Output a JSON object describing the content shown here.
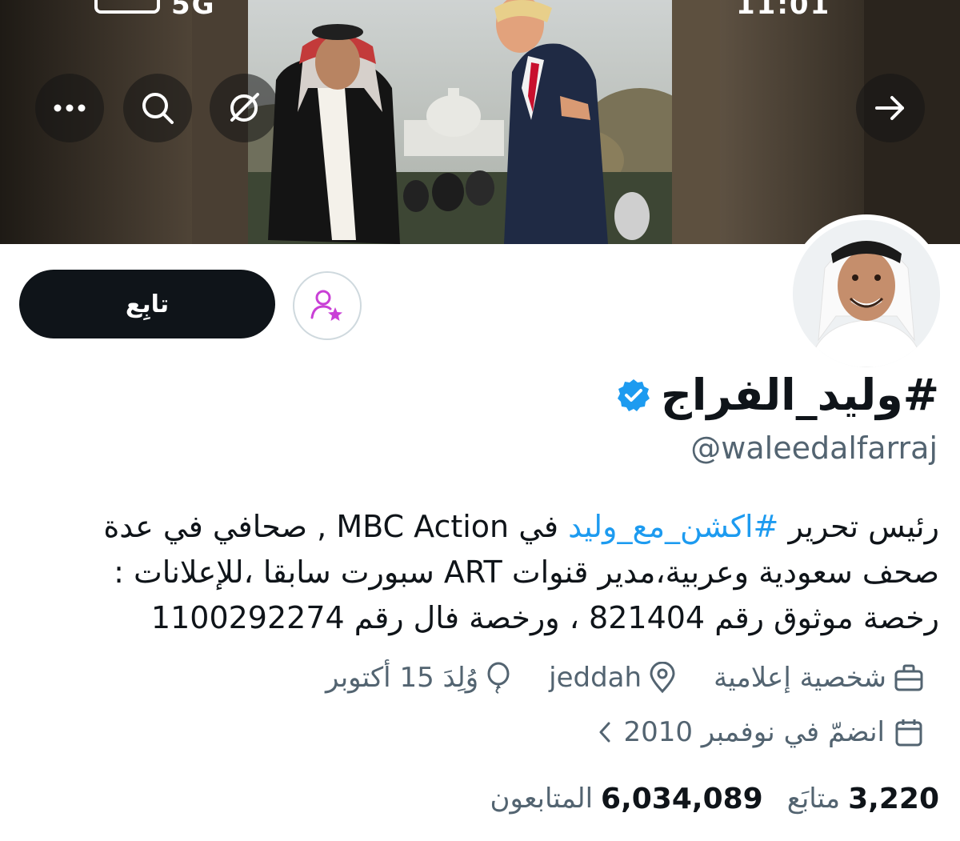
{
  "banner": {
    "status_time": "11:01",
    "status_signal": "5G"
  },
  "header_actions": {
    "more": "more-icon",
    "search": "search-icon",
    "grok": "grok-icon",
    "forward": "arrow-right-icon"
  },
  "profile": {
    "follow_label": "تابِع",
    "display_name": "#وليد_الفراج",
    "handle": "@waleedalfarraj",
    "verified": true,
    "bio": {
      "part1": "رئيس تحرير ",
      "hashtag": "#اكشن_مع_وليد",
      "part2": " في MBC Action , صحافي في عدة صحف سعودية وعربية،مدير قنوات ART سبورت سابقا ،للإعلانات : رخصة موثوق رقم 821404 ، ورخصة فال رقم 1100292274"
    },
    "category": "شخصية إعلامية",
    "location": "jeddah",
    "birthday": "وُلِدَ 15 أكتوبر",
    "joined": "انضمّ في نوفمبر 2010",
    "following_count": "3,220",
    "following_label": "متابَع",
    "followers_count": "6,034,089",
    "followers_label": "المتابعون"
  },
  "colors": {
    "accent": "#1d9bf0",
    "subscribe": "#c940d6",
    "text": "#0f1419",
    "secondary": "#536471"
  }
}
